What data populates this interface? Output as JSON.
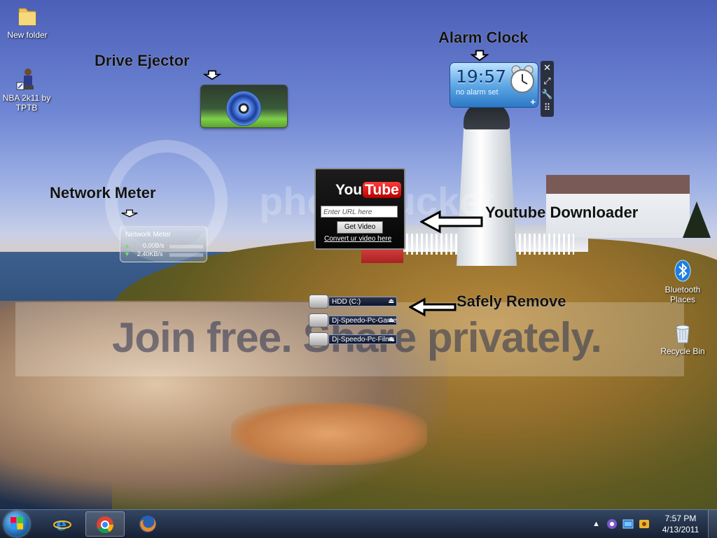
{
  "desktop_icons": [
    {
      "label": "New folder",
      "icon": "folder-icon"
    },
    {
      "label": "NBA 2k11 by TPTB",
      "icon": "nba-game-shortcut-icon"
    },
    {
      "label": "Bluetooth Places",
      "icon": "bluetooth-icon"
    },
    {
      "label": "Recycle Bin",
      "icon": "recycle-bin-icon"
    }
  ],
  "annotations": {
    "drive_ejector": "Drive Ejector",
    "alarm_clock": "Alarm Clock",
    "network_meter": "Network Meter",
    "youtube_downloader": "Youtube Downloader",
    "safely_remove": "Safely Remove"
  },
  "alarm_gadget": {
    "time": "19:57",
    "status": "no alarm set",
    "plus": "+"
  },
  "youtube_gadget": {
    "logo_you": "You",
    "logo_tube": "Tube",
    "url_placeholder": "Enter URL here",
    "button": "Get Video",
    "link": "Convert ur video here"
  },
  "network_gadget": {
    "title": "Network Meter",
    "upload": "0.00B/s",
    "download": "2.40KB/s"
  },
  "drives": [
    {
      "label": "HDD (C:)"
    },
    {
      "label": "Dj-Speedo-Pc-Games (S"
    },
    {
      "label": "Dj-Speedo-Pc-Films (E:)"
    }
  ],
  "watermark": {
    "text": "Join free. Share privately.",
    "logo_word": "photobucket"
  },
  "taskbar": {
    "time": "7:57 PM",
    "date": "4/13/2011",
    "tray_arrow": "▲"
  },
  "colors": {
    "taskbar": "#1a2740",
    "alarm_accent": "#2c78c6",
    "youtube_red": "#d00000"
  }
}
